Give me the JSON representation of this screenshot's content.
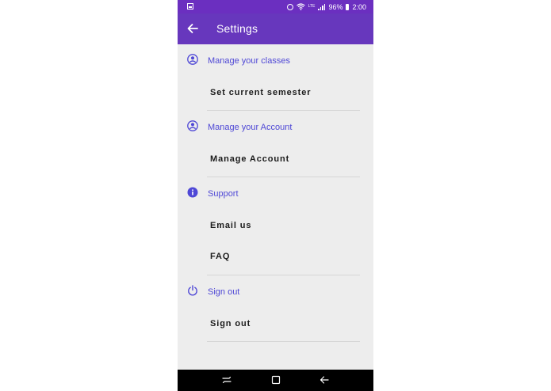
{
  "status_bar": {
    "battery": "96%",
    "time": "2:00",
    "network": "LTE",
    "icons": [
      "gallery-icon",
      "alarm-icon",
      "wifi-icon",
      "signal-icon",
      "battery-icon"
    ]
  },
  "app_bar": {
    "title": "Settings",
    "back_icon": "arrow-left-icon"
  },
  "sections": [
    {
      "header": "Manage your classes",
      "icon": "account-circle-icon",
      "items": [
        "Set current semester"
      ]
    },
    {
      "header": "Manage your Account",
      "icon": "account-circle-icon",
      "items": [
        "Manage Account"
      ]
    },
    {
      "header": "Support",
      "icon": "info-icon",
      "items": [
        "Email us",
        "FAQ"
      ]
    },
    {
      "header": "Sign out",
      "icon": "power-icon",
      "items": [
        "Sign out"
      ]
    }
  ],
  "nav_bar": {
    "icons": [
      "recents-icon",
      "home-icon",
      "back-icon"
    ]
  },
  "colors": {
    "app_bar": "#6737bd",
    "status_bar": "#6b2fc0",
    "section_header": "#4f48d6",
    "background": "#ededed",
    "item_text": "#1b1b1b"
  }
}
